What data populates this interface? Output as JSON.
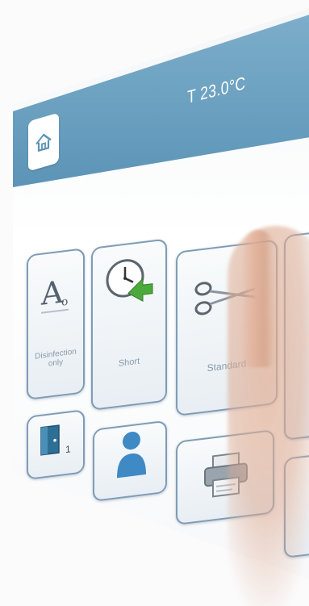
{
  "header": {
    "temperature": "T 23.0°C"
  },
  "tiles": [
    {
      "label": "Disinfection only",
      "icon": "letter-a-icon"
    },
    {
      "label": "Short",
      "icon": "clock-arrow-icon"
    },
    {
      "label": "Standard",
      "icon": "scissors-icon"
    },
    {
      "label": "",
      "icon": "door-icon",
      "badge": "1"
    },
    {
      "label": "",
      "icon": "user-icon"
    },
    {
      "label": "",
      "icon": "printer-icon"
    }
  ],
  "colors": {
    "header": "#6aa0c0",
    "tile_border": "#7f9cb7",
    "label": "#8a9aaa"
  }
}
